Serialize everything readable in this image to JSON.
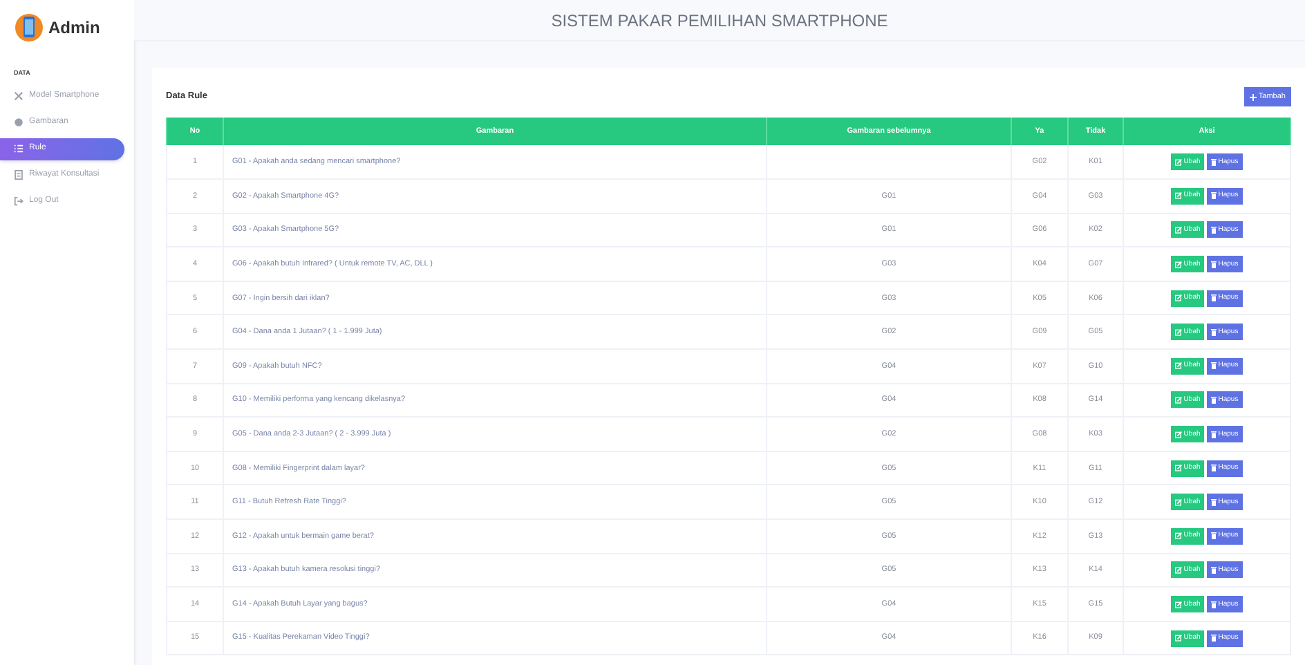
{
  "brand": "Admin",
  "sidebar": {
    "section": "DATA",
    "items": [
      {
        "label": "Model Smartphone",
        "selected": false
      },
      {
        "label": "Gambaran",
        "selected": false
      },
      {
        "label": "Rule",
        "selected": true
      },
      {
        "label": "Riwayat Konsultasi",
        "selected": false
      },
      {
        "label": "Log Out",
        "selected": false
      }
    ]
  },
  "header": {
    "title": "SISTEM PAKAR PEMILIHAN SMARTPHONE"
  },
  "card": {
    "title": "Data Rule",
    "add_button": "Tambah"
  },
  "table": {
    "columns": [
      "No",
      "Gambaran",
      "Gambaran sebelumnya",
      "Ya",
      "Tidak",
      "Aksi"
    ],
    "rows": [
      {
        "no": "1",
        "gambaran": "G01 - Apakah anda sedang mencari smartphone?",
        "sebelumnya": "",
        "ya": "G02",
        "tidak": "K01",
        "edit": "Ubah",
        "delete": "Hapus"
      },
      {
        "no": "2",
        "gambaran": "G02 - Apakah Smartphone 4G?",
        "sebelumnya": "G01",
        "ya": "G04",
        "tidak": "G03",
        "edit": "Ubah",
        "delete": "Hapus"
      },
      {
        "no": "3",
        "gambaran": "G03 - Apakah Smartphone 5G?",
        "sebelumnya": "G01",
        "ya": "G06",
        "tidak": "K02",
        "edit": "Ubah",
        "delete": "Hapus"
      },
      {
        "no": "4",
        "gambaran": "G06 - Apakah butuh Infrared? ( Untuk remote TV, AC, DLL )",
        "sebelumnya": "G03",
        "ya": "K04",
        "tidak": "G07",
        "edit": "Ubah",
        "delete": "Hapus"
      },
      {
        "no": "5",
        "gambaran": "G07 - Ingin bersih dari iklan?",
        "sebelumnya": "G03",
        "ya": "K05",
        "tidak": "K06",
        "edit": "Ubah",
        "delete": "Hapus"
      },
      {
        "no": "6",
        "gambaran": "G04 - Dana anda 1 Jutaan? ( 1 - 1.999 Juta)",
        "sebelumnya": "G02",
        "ya": "G09",
        "tidak": "G05",
        "edit": "Ubah",
        "delete": "Hapus"
      },
      {
        "no": "7",
        "gambaran": "G09 - Apakah butuh NFC?",
        "sebelumnya": "G04",
        "ya": "K07",
        "tidak": "G10",
        "edit": "Ubah",
        "delete": "Hapus"
      },
      {
        "no": "8",
        "gambaran": "G10 - Memiliki performa yang kencang dikelasnya?",
        "sebelumnya": "G04",
        "ya": "K08",
        "tidak": "G14",
        "edit": "Ubah",
        "delete": "Hapus"
      },
      {
        "no": "9",
        "gambaran": "G05 - Dana anda 2-3 Jutaan? ( 2 - 3.999 Juta )",
        "sebelumnya": "G02",
        "ya": "G08",
        "tidak": "K03",
        "edit": "Ubah",
        "delete": "Hapus"
      },
      {
        "no": "10",
        "gambaran": "G08 - Memiliki Fingerprint dalam layar?",
        "sebelumnya": "G05",
        "ya": "K11",
        "tidak": "G11",
        "edit": "Ubah",
        "delete": "Hapus"
      },
      {
        "no": "11",
        "gambaran": "G11 - Butuh Refresh Rate Tinggi?",
        "sebelumnya": "G05",
        "ya": "K10",
        "tidak": "G12",
        "edit": "Ubah",
        "delete": "Hapus"
      },
      {
        "no": "12",
        "gambaran": "G12 - Apakah untuk bermain game berat?",
        "sebelumnya": "G05",
        "ya": "K12",
        "tidak": "G13",
        "edit": "Ubah",
        "delete": "Hapus"
      },
      {
        "no": "13",
        "gambaran": "G13 - Apakah butuh kamera resolusi tinggi?",
        "sebelumnya": "G05",
        "ya": "K13",
        "tidak": "K14",
        "edit": "Ubah",
        "delete": "Hapus"
      },
      {
        "no": "14",
        "gambaran": "G14 - Apakah Butuh Layar yang bagus?",
        "sebelumnya": "G04",
        "ya": "K15",
        "tidak": "G15",
        "edit": "Ubah",
        "delete": "Hapus"
      },
      {
        "no": "15",
        "gambaran": "G15 - Kualitas Perekaman Video Tinggi?",
        "sebelumnya": "G04",
        "ya": "K16",
        "tidak": "K09",
        "edit": "Ubah",
        "delete": "Hapus"
      }
    ]
  }
}
